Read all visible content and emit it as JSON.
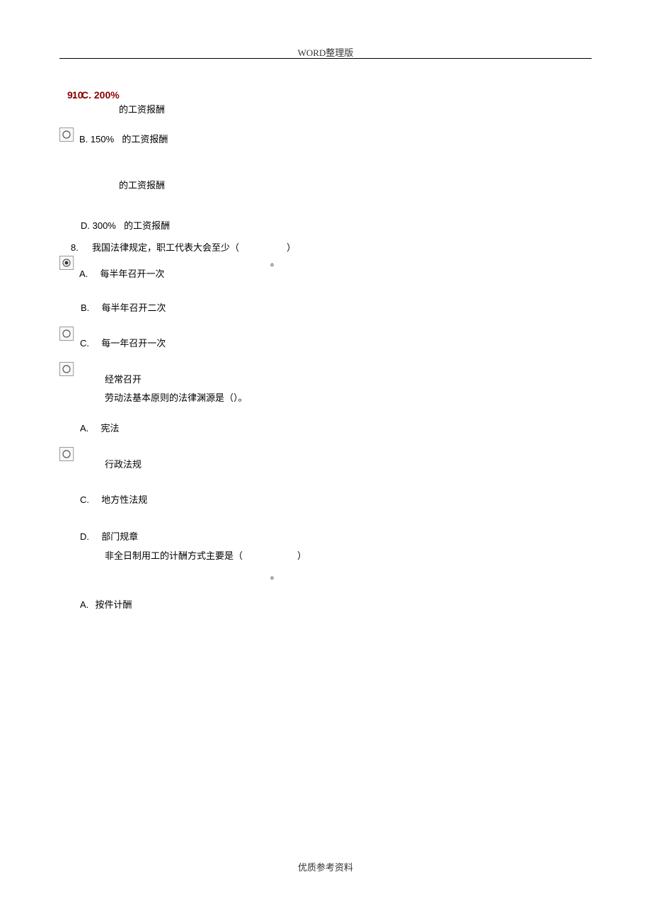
{
  "header": "WORD整理版",
  "footer": "优质参考资料",
  "redOverlay": {
    "a": "9.",
    "b": "10.",
    "c": "C. 200%"
  },
  "q7": {
    "optA_tail": "的工资报酬",
    "optB_label": "B. 150%",
    "optB_tail": "的工资报酬",
    "optC_tail": "的工资报酬",
    "optD_label": "D. 300%",
    "optD_tail": "的工资报酬"
  },
  "q8": {
    "num": "8.",
    "stem": "我国法律规定，职工代表大会至少（",
    "close1": "）",
    "close2": "。",
    "optA_label": "A.",
    "optA_text": "每半年召开一次",
    "optB_label": "B.",
    "optB_text": "每半年召开二次",
    "optC_label": "C.",
    "optC_text": "每一年召开一次",
    "optD_text": "经常召开"
  },
  "q9": {
    "stem": "劳动法基本原则的法律渊源是（）。",
    "optA_label": "A.",
    "optA_text": "宪法",
    "optB_text": "行政法规",
    "optC_label": "C.",
    "optC_text": "地方性法规",
    "optD_label": "D.",
    "optD_text": "部门规章"
  },
  "q10": {
    "stem": "非全日制用工的计酬方式主要是（",
    "close1": "）",
    "close2": "。",
    "optA_label": "A.",
    "optA_text": "按件计酬"
  }
}
